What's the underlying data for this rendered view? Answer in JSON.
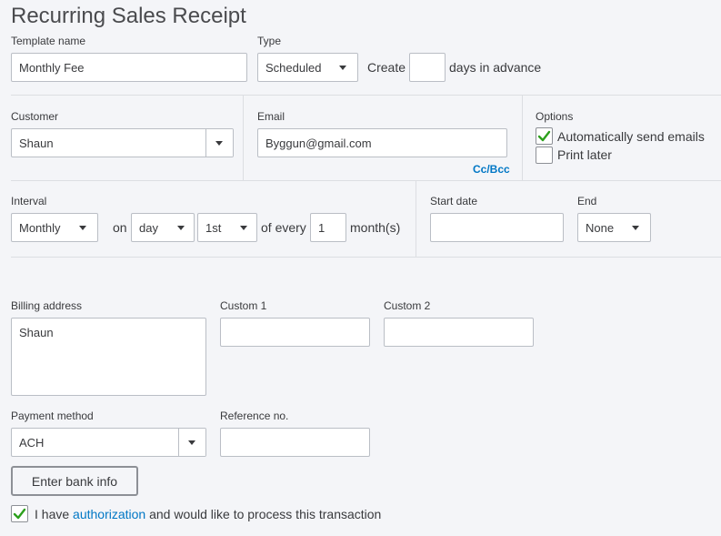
{
  "page": {
    "title": "Recurring Sales Receipt"
  },
  "template": {
    "name_label": "Template name",
    "name_value": "Monthly Fee",
    "type_label": "Type",
    "type_value": "Scheduled",
    "create_label": "Create",
    "create_value": "",
    "days_advance_label": "days in advance"
  },
  "customer": {
    "label": "Customer",
    "value": "Shaun"
  },
  "email": {
    "label": "Email",
    "value": "Byggun@gmail.com",
    "ccbcc": "Cc/Bcc"
  },
  "options": {
    "label": "Options",
    "auto_send_label": "Automatically send emails",
    "auto_send_checked": true,
    "print_later_label": "Print later",
    "print_later_checked": false
  },
  "interval": {
    "label": "Interval",
    "frequency": "Monthly",
    "on_label": "on",
    "day_mode": "day",
    "day_value": "1st",
    "of_every_label": "of every",
    "every_value": "1",
    "unit_label": "month(s)"
  },
  "schedule": {
    "start_label": "Start date",
    "start_value": "",
    "end_label": "End",
    "end_value": "None"
  },
  "billing": {
    "label": "Billing address",
    "value": "Shaun"
  },
  "custom": {
    "custom1_label": "Custom 1",
    "custom1_value": "",
    "custom2_label": "Custom 2",
    "custom2_value": ""
  },
  "payment": {
    "method_label": "Payment method",
    "method_value": "ACH",
    "reference_label": "Reference no.",
    "reference_value": "",
    "bank_button": "Enter bank info"
  },
  "authorization": {
    "checked": true,
    "prefix": "I have",
    "link": "authorization",
    "suffix": "and would like to process this transaction"
  },
  "colors": {
    "accent": "#0077c5",
    "check": "#2ca01c",
    "background": "#f4f5f8",
    "border": "#babec5"
  }
}
